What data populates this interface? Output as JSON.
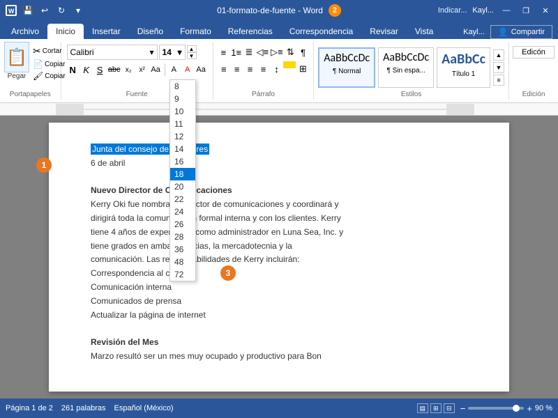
{
  "titleBar": {
    "filename": "01-formato-de-fuente - Word",
    "badge": "2",
    "windowControls": [
      "—",
      "❐",
      "✕"
    ]
  },
  "ribbonTabs": {
    "tabs": [
      "Archivo",
      "Inicio",
      "Insertar",
      "Diseño",
      "Formato",
      "Referencias",
      "Correspondencia",
      "Revisar",
      "Vista"
    ],
    "activeTab": "Inicio",
    "indicateText": "Indicar...",
    "userName": "Kayl...",
    "shareLabel": "Compartir"
  },
  "fontGroup": {
    "fontName": "Calibri",
    "fontSize": "14",
    "bold": "N",
    "italic": "K",
    "underline": "S",
    "strikethrough": "abc",
    "subscript": "x₂",
    "superscript": "x²",
    "label": "Fuente"
  },
  "fontSizeDropdown": {
    "sizes": [
      "8",
      "9",
      "10",
      "11",
      "12",
      "14",
      "16",
      "18",
      "20",
      "22",
      "24",
      "26",
      "28",
      "36",
      "48",
      "72"
    ],
    "selectedSize": "18"
  },
  "styles": {
    "items": [
      {
        "label": "¶ Normal",
        "preview": "AaBbCcDc",
        "active": true
      },
      {
        "label": "¶ Sin espa...",
        "preview": "AaBbCcDc",
        "active": false
      },
      {
        "label": "Título 1",
        "preview": "AaBbCc",
        "active": false
      }
    ],
    "label": "Estilos"
  },
  "paragraphGroup": {
    "label": "Párrafo"
  },
  "clipboardGroup": {
    "pasteLabel": "Pegar",
    "label": "Portapapeles"
  },
  "editionGroup": {
    "label": "Edición"
  },
  "document": {
    "line1": "Junta del consejo de directores",
    "line2": "6 de abril",
    "line3": "",
    "line4": "Nuevo Director de Comunicaciones",
    "line5": "Kerry Oki fue nombrado director de comunicaciones y coordinará y",
    "line6": "dirigirá toda la comunicación formal interna y con los clientes. Kerry",
    "line7": "tiene 4 años de experiencia como administrador en Luna Sea, Inc. y",
    "line8": "tiene grados en ambas ciencias, la mercadotecnia y la",
    "line9": "comunicación. Las responsabilidades de Kerry incluirán:",
    "line10": "Correspondencia al cliente",
    "line11": "Comunicación interna",
    "line12": "Comunicados de prensa",
    "line13": "Actualizar la página de internet",
    "line14": "",
    "line15": "Revisión del Mes",
    "line16": "Marzo resultó ser un mes muy ocupado y productivo para Bon"
  },
  "statusBar": {
    "pageInfo": "Página 1 de 2",
    "wordCount": "261 palabras",
    "language": "Español (México)",
    "zoomPercent": "90 %"
  },
  "badges": {
    "badge1": "1",
    "badge2": "2",
    "badge3": "3"
  }
}
